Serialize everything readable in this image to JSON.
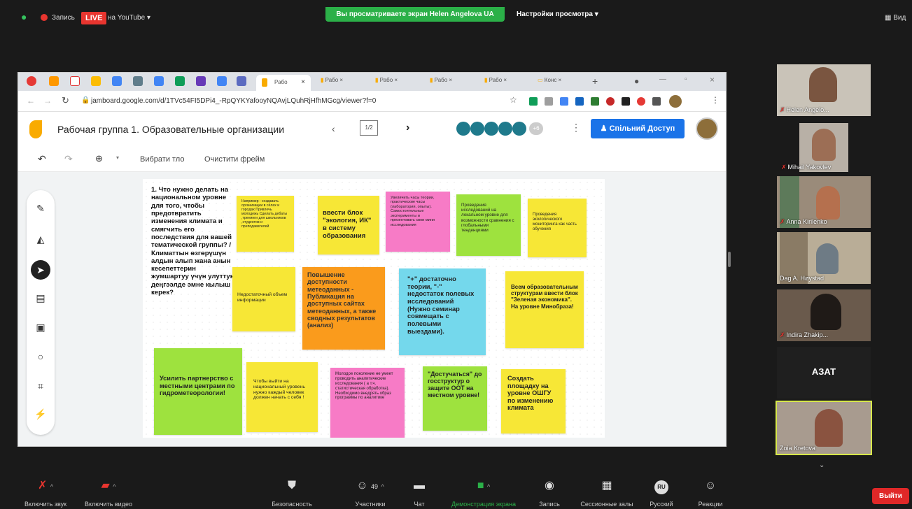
{
  "topbar": {
    "record_label": "Запись",
    "live_label": "LIVE",
    "youtube_label": "на YouTube",
    "share_banner": "Вы просматриваете экран Helen Angelova UA",
    "view_settings": "Настройки просмотра",
    "view_label": "Вид"
  },
  "browser": {
    "tab_label": "Рабо",
    "tab_last": "Конс",
    "url": "jamboard.google.com/d/1TVc54FI5DPi4_-RpQYKYafooyNQAvjLQuhRjHfhMGcg/viewer?f=0"
  },
  "jamboard": {
    "title": "Рабочая группа 1. Образовательные организации",
    "frame_counter": "1/2",
    "plus_count": "+6",
    "share_button": "Спільний Доступ",
    "toolbar": {
      "background": "Вибрати тло",
      "clear": "Очистити фрейм"
    },
    "question": "1. Что нужно делать на национальном уровне для того, чтобы предотвратить изменения климата и смягчить его последствия для вашей тематической группы? / Климаттын өзгөрүшүн алдын алып жана анын кесепеттерин жумшартуу үчүн улуттук деңгээлде эмне кылыш керек?",
    "notes": [
      {
        "text": "Например : создавать организации в сёлах и городах Привлечь молодежь Сделать дебаты ,тренинги для школьников ,студентов и преподавателей",
        "color": "#f7e736"
      },
      {
        "text": "ввести блок \"экология, ИК\" в систему образования",
        "color": "#f7e736"
      },
      {
        "text": "Увеличить часы теории, практические часы (лаборатория, опыты). Самостоятельные эксперименты и презентовать свои мини исследования",
        "color": "#f77bc6"
      },
      {
        "text": "Проведения исследований на локальном уровне для возможности сравнения с глобальными тенденциями",
        "color": "#9ee23e"
      },
      {
        "text": "Проведения экологического мониторинга как часть обучения",
        "color": "#f7e736"
      },
      {
        "text": "Недостаточный объем информации",
        "color": "#f7e736"
      },
      {
        "text": "Повышение доступности метеоданных - Публикация на доступных сайтах метеоданных, а также сводных результатов (анализ)",
        "color": "#fa9b1c"
      },
      {
        "text": "\"+\" достаточно теории, \"-\" недостаток полевых исследований (Нужно семинар совмещать с полевыми выездами).",
        "color": "#74d8ec"
      },
      {
        "text": "Всем образовательным структурам ввести блок \"Зеленая экономика\". На уровне Минобраза!",
        "color": "#f7e736"
      },
      {
        "text": "Усилить партнерство с местными центрами по гидрометеорологии!",
        "color": "#9ee23e"
      },
      {
        "text": "Чтобы выйти на национальный уровень нужно каждый человек должен начать с себя !",
        "color": "#f7e736"
      },
      {
        "text": "Молодое поколение не умеет проводить аналитические исследования ( а т.ч. статистическая обработка). Необходимо внедрять образ программы по аналитике",
        "color": "#f77bc6"
      },
      {
        "text": "\"Достучаться\" до госструктур о защите ООТ на местном уровне!",
        "color": "#9ee23e"
      },
      {
        "text": "Создать площадку на уровне ОШГУ по изменению климата",
        "color": "#f7e736"
      }
    ]
  },
  "participants": [
    {
      "name": "Helen Angelo..."
    },
    {
      "name": "Mihail Yakovlev"
    },
    {
      "name": "Anna Kirilenko"
    },
    {
      "name": "Dag A. Høystad"
    },
    {
      "name": "Indira Zhakip..."
    },
    {
      "name": "АЗАТ"
    },
    {
      "name": "Zoia Kretova"
    }
  ],
  "bottombar": {
    "mute": "Включить звук",
    "video": "Включить видео",
    "security": "Безопасность",
    "participants": "Участники",
    "participants_count": "49",
    "chat": "Чат",
    "share": "Демонстрация экрана",
    "record": "Запись",
    "rooms": "Сессионные залы",
    "language": "Русский",
    "language_code": "RU",
    "reactions": "Реакции",
    "leave": "Выйти"
  },
  "colors": {
    "accent_blue": "#1a73e8",
    "zoom_green": "#2bb048",
    "leave_red": "#e02828"
  }
}
